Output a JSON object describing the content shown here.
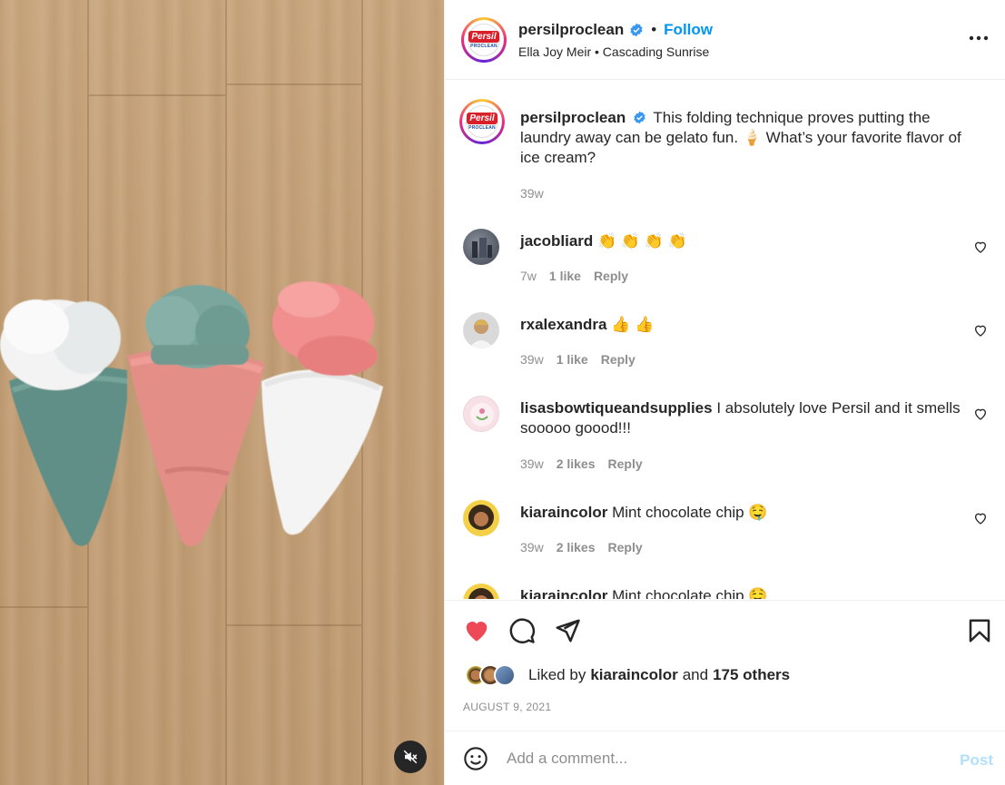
{
  "header": {
    "username": "persilproclean",
    "follow_label": "Follow",
    "separator": "•",
    "subtitle": "Ella Joy Meir • Cascading Sunrise",
    "logo_text": "Persil",
    "logo_subtext": "PROCLEAN"
  },
  "caption": {
    "username": "persilproclean",
    "text": "This folding technique proves putting the laundry away can be gelato fun. 🍦 What’s your favorite flavor of ice cream?",
    "time": "39w"
  },
  "comments": [
    {
      "username": "jacobliard",
      "text": "👏 👏 👏 👏",
      "time": "7w",
      "likes": "1 like",
      "reply": "Reply"
    },
    {
      "username": "rxalexandra",
      "text": "👍 👍",
      "time": "39w",
      "likes": "1 like",
      "reply": "Reply"
    },
    {
      "username": "lisasbowtiqueandsupplies",
      "text": "I absolutely love Persil and it smells sooooo goood!!!",
      "time": "39w",
      "likes": "2 likes",
      "reply": "Reply"
    },
    {
      "username": "kiaraincolor",
      "text": "Mint chocolate chip 🤤",
      "time": "39w",
      "likes": "2 likes",
      "reply": "Reply"
    },
    {
      "username": "kiaraincolor",
      "text": "Mint chocolate chip 🤤",
      "time": "",
      "likes": "",
      "reply": ""
    }
  ],
  "likes": {
    "prefix": "Liked by",
    "user": "kiaraincolor",
    "and": "and",
    "others": "175 others"
  },
  "date": "AUGUST 9, 2021",
  "add_comment": {
    "placeholder": "Add a comment...",
    "post_label": "Post"
  },
  "colors": {
    "like_red": "#ed4956",
    "link_blue": "#0095f6",
    "post_disabled": "#b2dffc",
    "verified_blue": "#3897f0"
  },
  "icons": [
    "heart-icon",
    "comment-icon",
    "share-icon",
    "bookmark-icon",
    "emoji-icon",
    "more-icon",
    "mute-icon",
    "verified-badge-icon"
  ]
}
